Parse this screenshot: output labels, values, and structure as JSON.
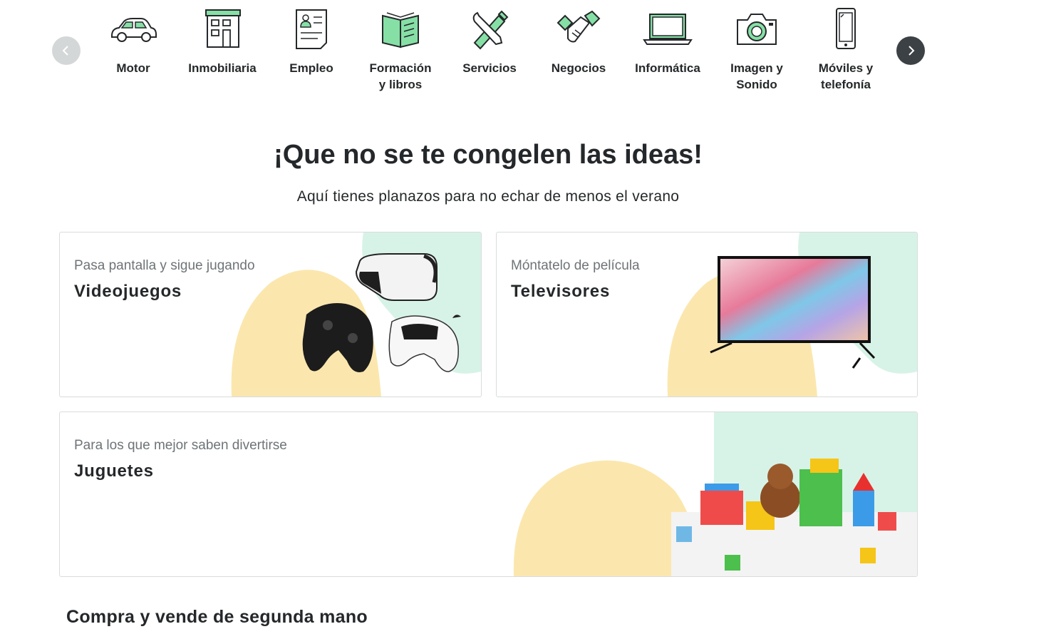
{
  "categories": [
    {
      "label": "Motor",
      "icon": "car-icon"
    },
    {
      "label": "Inmobiliaria",
      "icon": "building-icon"
    },
    {
      "label": "Empleo",
      "icon": "resume-icon"
    },
    {
      "label": "Formación\ny libros",
      "icon": "book-icon"
    },
    {
      "label": "Servicios",
      "icon": "tools-icon"
    },
    {
      "label": "Negocios",
      "icon": "handshake-icon"
    },
    {
      "label": "Informática",
      "icon": "laptop-icon"
    },
    {
      "label": "Imagen y\nSonido",
      "icon": "camera-icon"
    },
    {
      "label": "Móviles y\ntelefonía",
      "icon": "phone-icon"
    }
  ],
  "carousel": {
    "prev_icon": "chevron-left-icon",
    "next_icon": "chevron-right-icon"
  },
  "hero": {
    "title": "¡Que no se te congelen las ideas!",
    "subtitle": "Aquí tienes planazos para no echar de menos el verano"
  },
  "cards": {
    "videojuegos": {
      "kicker": "Pasa pantalla y sigue jugando",
      "title": "Videojuegos"
    },
    "televisores": {
      "kicker": "Móntatelo de película",
      "title": "Televisores"
    },
    "juguetes": {
      "kicker": "Para los que mejor saben divertirse",
      "title": "Juguetes"
    }
  },
  "section": {
    "title": "Compra y vende de segunda mano"
  },
  "colors": {
    "accent": "#13c1ac",
    "icon_fill": "#86e0a6",
    "text": "#25282a",
    "muted": "#6e7477",
    "blob_yellow": "#fbe7ae",
    "blob_green": "#d7f3e7"
  }
}
